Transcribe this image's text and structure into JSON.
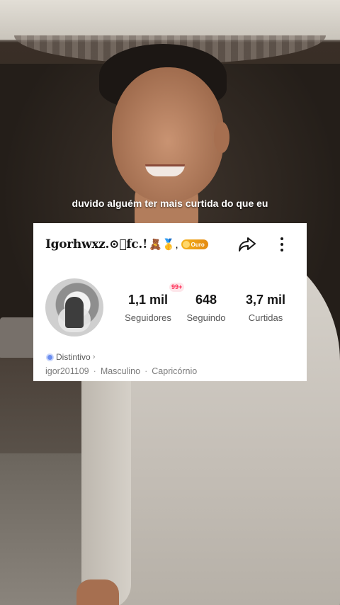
{
  "caption": "duvido alguém ter mais curtida do que eu",
  "profile": {
    "username": "Igorhwxz.⊙⃗fc.!",
    "emojis": "🧸🥇,",
    "level_badge": "Ouro",
    "handle": "igor201109",
    "gender": "Masculino",
    "sign": "Capricórnio",
    "distintivo_label": "Distintivo",
    "distintivo_chevron": "›",
    "meta_separator": "·"
  },
  "stats": [
    {
      "value": "1,1 mil",
      "label": "Seguidores"
    },
    {
      "value": "648",
      "label": "Seguindo"
    },
    {
      "value": "3,7 mil",
      "label": "Curtidas"
    }
  ],
  "notification_count": "99+",
  "icons": {
    "share": "share-arrow-icon",
    "more": "more-vertical-icon",
    "distintivo": "shield-badge-icon",
    "ouro_badge": "gold-level-icon"
  },
  "colors": {
    "card_bg": "#ffffff",
    "notif_red": "#fe2c55",
    "ouro_gold": "#f5b21a",
    "distintivo_blue": "#6b8ef0"
  }
}
